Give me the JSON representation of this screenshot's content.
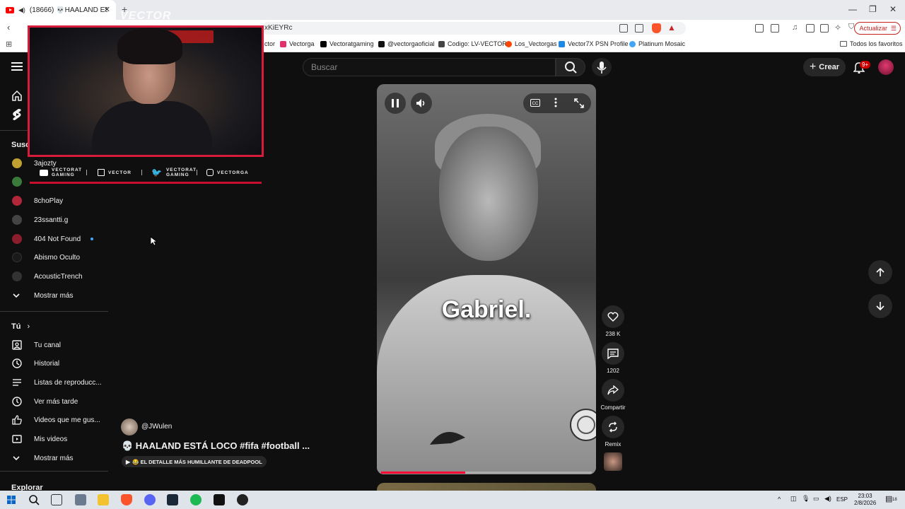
{
  "browser": {
    "tab_title": "(18666) 💀HAALAND ESTÁ L...",
    "url_fragment": "xKiEYRc",
    "update_button": "Actualizar",
    "bookmarks": [
      {
        "label": "ctor",
        "color": "#9c27b0"
      },
      {
        "label": "Vectorga",
        "color": "#e1306c"
      },
      {
        "label": "Vectoratgaming",
        "color": "#000000"
      },
      {
        "label": "@vectorgaoficial",
        "color": "#111111"
      },
      {
        "label": "Codigo: LV-VECTOR",
        "color": "#444444"
      },
      {
        "label": "Los_Vectorgas",
        "color": "#ff4500"
      },
      {
        "label": "Vector7X PSN Profile",
        "color": "#1e88e5"
      },
      {
        "label": "Platinum Mosaic",
        "color": "#42a5f5"
      }
    ],
    "all_bookmarks": "Todos los favoritos"
  },
  "youtube": {
    "search_placeholder": "Buscar",
    "create_button": "Crear",
    "notification_count": "9+"
  },
  "sidebar": {
    "subs_heading": "Susc",
    "subscriptions": [
      {
        "label": "3ajozty",
        "color": "#c0a030"
      },
      {
        "label": "",
        "color": "#3a7a3a"
      },
      {
        "label": "8choPlay",
        "color": "#b2263a"
      },
      {
        "label": "23ssantti.g",
        "color": "#444444"
      },
      {
        "label": "404 Not Found",
        "color": "#8b1d2c"
      },
      {
        "label": "Abismo Oculto",
        "color": "#1a1a1a"
      },
      {
        "label": "AcousticTrench",
        "color": "#333333"
      }
    ],
    "show_more_1": "Mostrar más",
    "you_heading": "Tú",
    "you_items": [
      {
        "label": "Tu canal",
        "icon": "channel-icon"
      },
      {
        "label": "Historial",
        "icon": "history-icon"
      },
      {
        "label": "Listas de reproducc...",
        "icon": "playlist-icon"
      },
      {
        "label": "Ver más tarde",
        "icon": "watch-later-icon"
      },
      {
        "label": "Videos que me gus...",
        "icon": "like-icon"
      },
      {
        "label": "Mis videos",
        "icon": "my-videos-icon"
      }
    ],
    "show_more_2": "Mostrar más",
    "explore_heading": "Explorar"
  },
  "overlay": {
    "logo_text": "VECTOR",
    "socials": [
      {
        "top": "VECTORAT",
        "bottom": "GAMING",
        "icon": "youtube-icon"
      },
      {
        "top": "",
        "bottom": "VECTOR",
        "icon": "twitch-icon"
      },
      {
        "top": "VECTORAT",
        "bottom": "GAMING",
        "icon": "twitter-icon"
      },
      {
        "top": "",
        "bottom": "VECTORGA",
        "icon": "instagram-icon"
      }
    ]
  },
  "short": {
    "caption": "Gabriel.",
    "progress": 0.4,
    "channel": "@JWulen",
    "title": "💀 HAALAND ESTÁ LOCO #fifa #football ...",
    "music": "😂 EL DETALLE MÁS HUMILLANTE DE DEADPOOL",
    "likes": "238 K",
    "comments": "1202",
    "share": "Compartir",
    "remix": "Remix"
  },
  "taskbar": {
    "lang": "ESP",
    "time": "23:03",
    "date": "2/8/2026",
    "notif": "18"
  }
}
